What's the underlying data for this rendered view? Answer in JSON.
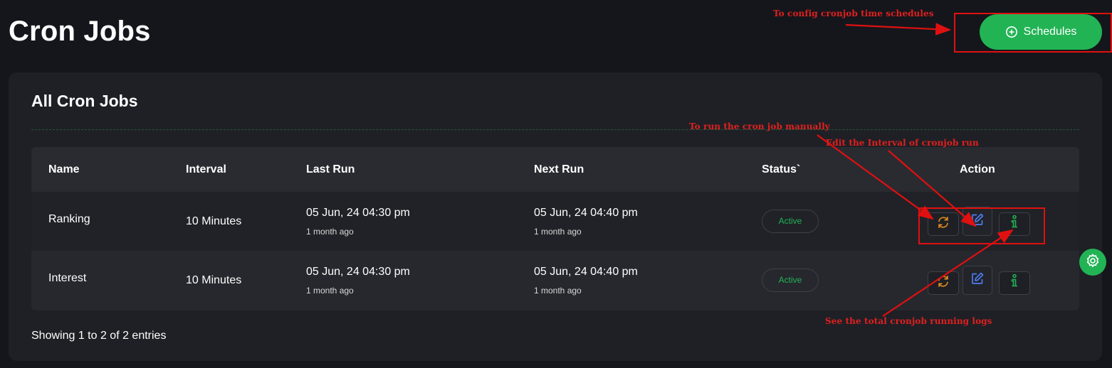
{
  "header": {
    "title": "Cron Jobs",
    "schedules_label": "Schedules",
    "schedules_icon": "plus-circle-icon"
  },
  "card": {
    "title": "All Cron Jobs",
    "columns": [
      "Name",
      "Interval",
      "Last Run",
      "Next Run",
      "Status`",
      "Action"
    ],
    "rows": [
      {
        "name": "Ranking",
        "interval": "10 Minutes",
        "last_run": "05 Jun, 24 04:30 pm",
        "last_run_ago": "1 month ago",
        "next_run": "05 Jun, 24 04:40 pm",
        "next_run_ago": "1 month ago",
        "status": "Active"
      },
      {
        "name": "Interest",
        "interval": "10 Minutes",
        "last_run": "05 Jun, 24 04:30 pm",
        "last_run_ago": "1 month ago",
        "next_run": "05 Jun, 24 04:40 pm",
        "next_run_ago": "1 month ago",
        "status": "Active"
      }
    ],
    "actions": [
      "refresh-icon",
      "edit-icon",
      "info-icon"
    ],
    "footer": "Showing 1 to 2 of 2 entries"
  },
  "annotations": {
    "schedules": "To config cronjob time schedules",
    "run": "To run the cron job manually",
    "edit": "Edit the Interval of cronjob run",
    "logs": "See the total cronjob running logs"
  },
  "colors": {
    "background": "#15161b",
    "card": "#1f2025",
    "accent_green": "#22b355",
    "run_orange": "#e08a1e",
    "edit_blue": "#4d7cf0",
    "logs_green": "#22b355",
    "annotation_red": "#e01010"
  }
}
